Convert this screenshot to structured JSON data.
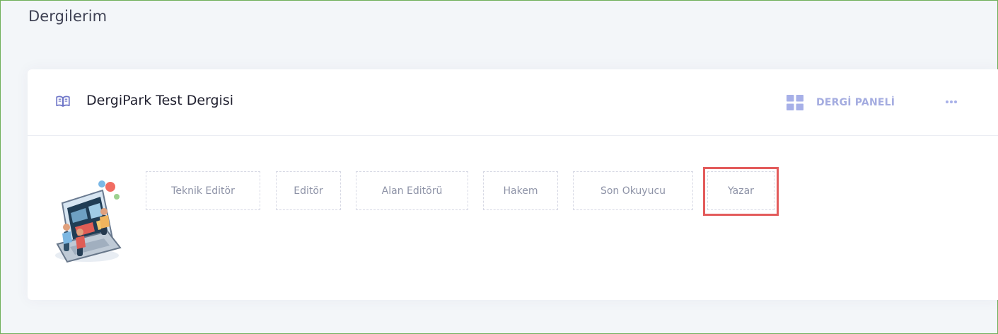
{
  "page": {
    "title": "Dergilerim"
  },
  "journal": {
    "title": "DergiPark Test Dergisi",
    "panel_label": "DERGİ PANELİ",
    "more_label": "•••",
    "roles": [
      "Teknik Editör",
      "Editör",
      "Alan Editörü",
      "Hakem",
      "Son Okuyucu",
      "Yazar"
    ],
    "highlighted_role": "Yazar"
  },
  "colors": {
    "frame_border": "#6fb05a",
    "page_background": "#f3f6f9",
    "card_background": "#ffffff",
    "title_text": "#3f4254",
    "journal_text": "#212130",
    "accent": "#a4ace0",
    "role_text": "#8e93a7",
    "role_border": "#d6d8e4",
    "highlight": "#e35b5b"
  },
  "icons": {
    "journal": "book-icon",
    "panel": "grid-icon",
    "more": "more-horizontal-icon",
    "illustration": "laptop-study-illustration"
  }
}
